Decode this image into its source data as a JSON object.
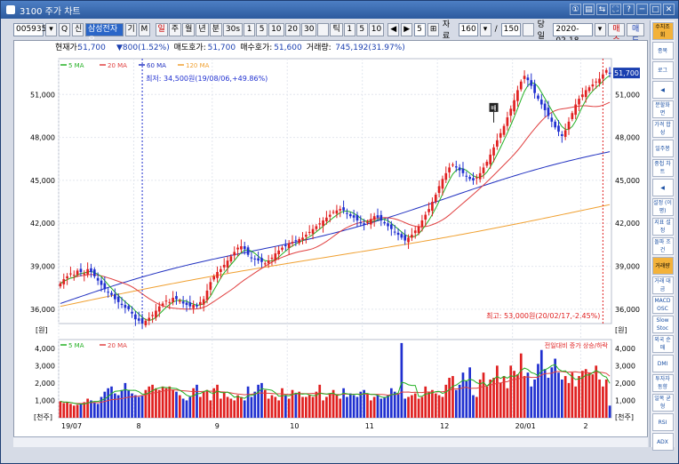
{
  "window": {
    "title": "3100 주가 차트",
    "controls": [
      "①",
      "▤",
      "⇆",
      "⛶",
      "?",
      "─",
      "□",
      "✕"
    ]
  },
  "toolbar": {
    "code": "005935",
    "btn_search": "Q",
    "btn_new": "신",
    "name": "삼성전자우",
    "btn_gi": "기",
    "btn_m": "M",
    "period": [
      "일",
      "주",
      "월",
      "년",
      "분",
      "30s",
      "1",
      "5",
      "10",
      "20",
      "30",
      "",
      "틱",
      "1",
      "5",
      "10"
    ],
    "nav_count": "5",
    "data_label": "자료",
    "data_count": "160",
    "data_total": "150",
    "sep": "/",
    "current_label": "당일",
    "date": "2020-02-18",
    "buy": "매수",
    "sell": "매도"
  },
  "quote": {
    "price_label": "현재가:",
    "price": "51,700",
    "change": "▼800(1.52%)",
    "ask_label": "매도호가:",
    "ask": "51,700",
    "bid_label": "매수호가:",
    "bid": "51,600",
    "vol_label": "거래량:",
    "vol": "745,192(31.97%)"
  },
  "colors": {
    "up": "#e02020",
    "down": "#2030d0",
    "ma5": "#22b022",
    "ma20": "#e04040",
    "ma60": "#2030c0",
    "ma120": "#f0a030"
  },
  "chart_data": [
    {
      "type": "candlestick",
      "legend": [
        "5 MA",
        "20 MA",
        "60 MA",
        "120 MA"
      ],
      "y_ticks": [
        "51,000",
        "48,000",
        "45,000",
        "42,000",
        "39,000",
        "36,000"
      ],
      "y_tick_values": [
        51000,
        48000,
        45000,
        42000,
        39000,
        36000
      ],
      "ylim": [
        35000,
        53500
      ],
      "y_unit": "[원]",
      "x_labels": [
        "19/07",
        "8",
        "9",
        "10",
        "11",
        "12",
        "20/01",
        "2"
      ],
      "x_label_idx": [
        0,
        22,
        45,
        67,
        89,
        111,
        133,
        153
      ],
      "last_price_label": "51,700",
      "low_annotation": "최저: 34,500원(19/08/06,+49.86%)",
      "high_annotation": "최고: 53,000원(20/02/17,-2.45%)",
      "marker": "배",
      "closes": [
        37800,
        38100,
        38300,
        38500,
        38400,
        38700,
        38600,
        38500,
        38800,
        38600,
        38300,
        38000,
        37700,
        37400,
        37200,
        37000,
        36700,
        36500,
        36300,
        36100,
        36000,
        35700,
        35300,
        35200,
        35000,
        35200,
        35400,
        35600,
        35900,
        36200,
        36400,
        36600,
        36500,
        36800,
        36700,
        36600,
        36400,
        36300,
        36200,
        36300,
        36200,
        36500,
        36700,
        37300,
        37900,
        38300,
        38600,
        38800,
        39100,
        39400,
        39700,
        40000,
        40300,
        40400,
        40200,
        39800,
        39600,
        39500,
        39400,
        39300,
        39200,
        39400,
        39600,
        39900,
        40100,
        40300,
        40400,
        40600,
        40700,
        40800,
        40900,
        41000,
        41200,
        41400,
        41600,
        41800,
        42000,
        42200,
        42400,
        42600,
        42800,
        42900,
        43000,
        42900,
        42700,
        42500,
        42400,
        42200,
        42000,
        41900,
        42100,
        42300,
        42500,
        42400,
        42200,
        42000,
        41800,
        41600,
        41400,
        41200,
        41000,
        40800,
        41000,
        41200,
        41500,
        41800,
        42200,
        42600,
        43000,
        43500,
        44000,
        44600,
        45100,
        45500,
        45900,
        46100,
        45900,
        45700,
        45500,
        45300,
        45100,
        45000,
        45200,
        45500,
        45900,
        46300,
        46800,
        47300,
        47800,
        48300,
        48800,
        49400,
        50000,
        50600,
        51300,
        51900,
        52300,
        52000,
        51600,
        51100,
        50700,
        50300,
        49900,
        49500,
        49100,
        48700,
        48400,
        48100,
        48500,
        49100,
        49700,
        50300,
        50700,
        51000,
        51300,
        51500,
        51700,
        51900,
        52100,
        52400,
        52700,
        52500
      ],
      "volumes": [
        0.95,
        0.85,
        0.9,
        0.8,
        0.7,
        0.75,
        0.8,
        0.9,
        1.1,
        1.0,
        0.9,
        0.8,
        1.2,
        1.5,
        1.7,
        1.8,
        1.4,
        1.3,
        1.6,
        2.0,
        1.6,
        1.4,
        1.3,
        1.2,
        1.3,
        1.6,
        1.8,
        1.9,
        1.7,
        1.6,
        1.8,
        1.7,
        1.8,
        1.6,
        1.5,
        1.3,
        1.1,
        1.0,
        1.2,
        1.7,
        1.9,
        1.2,
        1.5,
        1.6,
        1.0,
        1.7,
        1.9,
        1.1,
        1.5,
        1.2,
        1.1,
        1.0,
        1.3,
        1.2,
        1.0,
        1.8,
        1.2,
        1.5,
        1.9,
        2.0,
        1.6,
        1.1,
        1.3,
        1.2,
        1.0,
        1.7,
        1.3,
        1.1,
        1.6,
        1.4,
        1.5,
        1.2,
        1.2,
        1.3,
        1.2,
        1.5,
        1.9,
        1.0,
        1.2,
        1.4,
        1.6,
        1.3,
        1.1,
        1.7,
        1.2,
        1.4,
        1.3,
        1.2,
        1.5,
        1.6,
        1.4,
        1.0,
        1.2,
        1.3,
        1.1,
        1.2,
        1.3,
        1.7,
        1.5,
        1.4,
        4.3,
        1.1,
        1.2,
        1.3,
        1.4,
        1.1,
        1.2,
        1.8,
        1.5,
        1.6,
        1.4,
        1.3,
        1.2,
        1.9,
        2.3,
        2.4,
        1.6,
        1.9,
        2.6,
        2.1,
        2.9,
        1.3,
        1.2,
        2.2,
        2.6,
        1.8,
        2.2,
        2.3,
        3.0,
        2.0,
        2.4,
        1.7,
        3.0,
        2.7,
        2.5,
        3.7,
        2.4,
        2.6,
        1.8,
        2.2,
        3.1,
        3.9,
        2.8,
        2.3,
        2.9,
        3.4,
        2.6,
        2.2,
        2.4,
        2.0,
        2.6,
        1.8,
        2.4,
        2.7,
        2.8,
        2.6,
        2.5,
        3.0,
        2.2,
        1.8,
        2.2,
        0.7
      ],
      "vol_legend": [
        "5 MA",
        "20 MA"
      ],
      "vol_y_ticks": [
        "4,000",
        "3,000",
        "2,000",
        "1,000"
      ],
      "vol_y_tick_values": [
        4000,
        3000,
        2000,
        1000
      ],
      "vol_ylim": [
        0,
        4500
      ],
      "vol_unit": "[천주]",
      "vol_legend_right": "전일대비 증가 상승/하락"
    }
  ],
  "sidebar": [
    {
      "label": "수치조회",
      "sel": true
    },
    {
      "label": "종목",
      "sel": false
    },
    {
      "label": "로그",
      "sel": false
    },
    {
      "label": "◀",
      "sel": false
    },
    {
      "label": "분할화면",
      "sel": false
    },
    {
      "label": "가격 합성",
      "sel": false
    },
    {
      "label": "일주봉",
      "sel": false
    },
    {
      "label": "중첩 차트",
      "sel": false
    },
    {
      "label": "◀",
      "sel": false
    },
    {
      "label": "설정 (이평)",
      "sel": false
    },
    {
      "label": "지표 설정",
      "sel": false
    },
    {
      "label": "돌파 조건",
      "sel": false
    },
    {
      "label": "거래량",
      "sel": true
    },
    {
      "label": "거래 대금",
      "sel": false
    },
    {
      "label": "MACD OSC",
      "sel": false
    },
    {
      "label": "Slow Stoc",
      "sel": false
    },
    {
      "label": "외국 순매",
      "sel": false
    },
    {
      "label": "DMI",
      "sel": false
    },
    {
      "label": "투자자 동향",
      "sel": false
    },
    {
      "label": "일목 균형",
      "sel": false
    },
    {
      "label": "RSI",
      "sel": false
    },
    {
      "label": "ADX",
      "sel": false
    }
  ]
}
